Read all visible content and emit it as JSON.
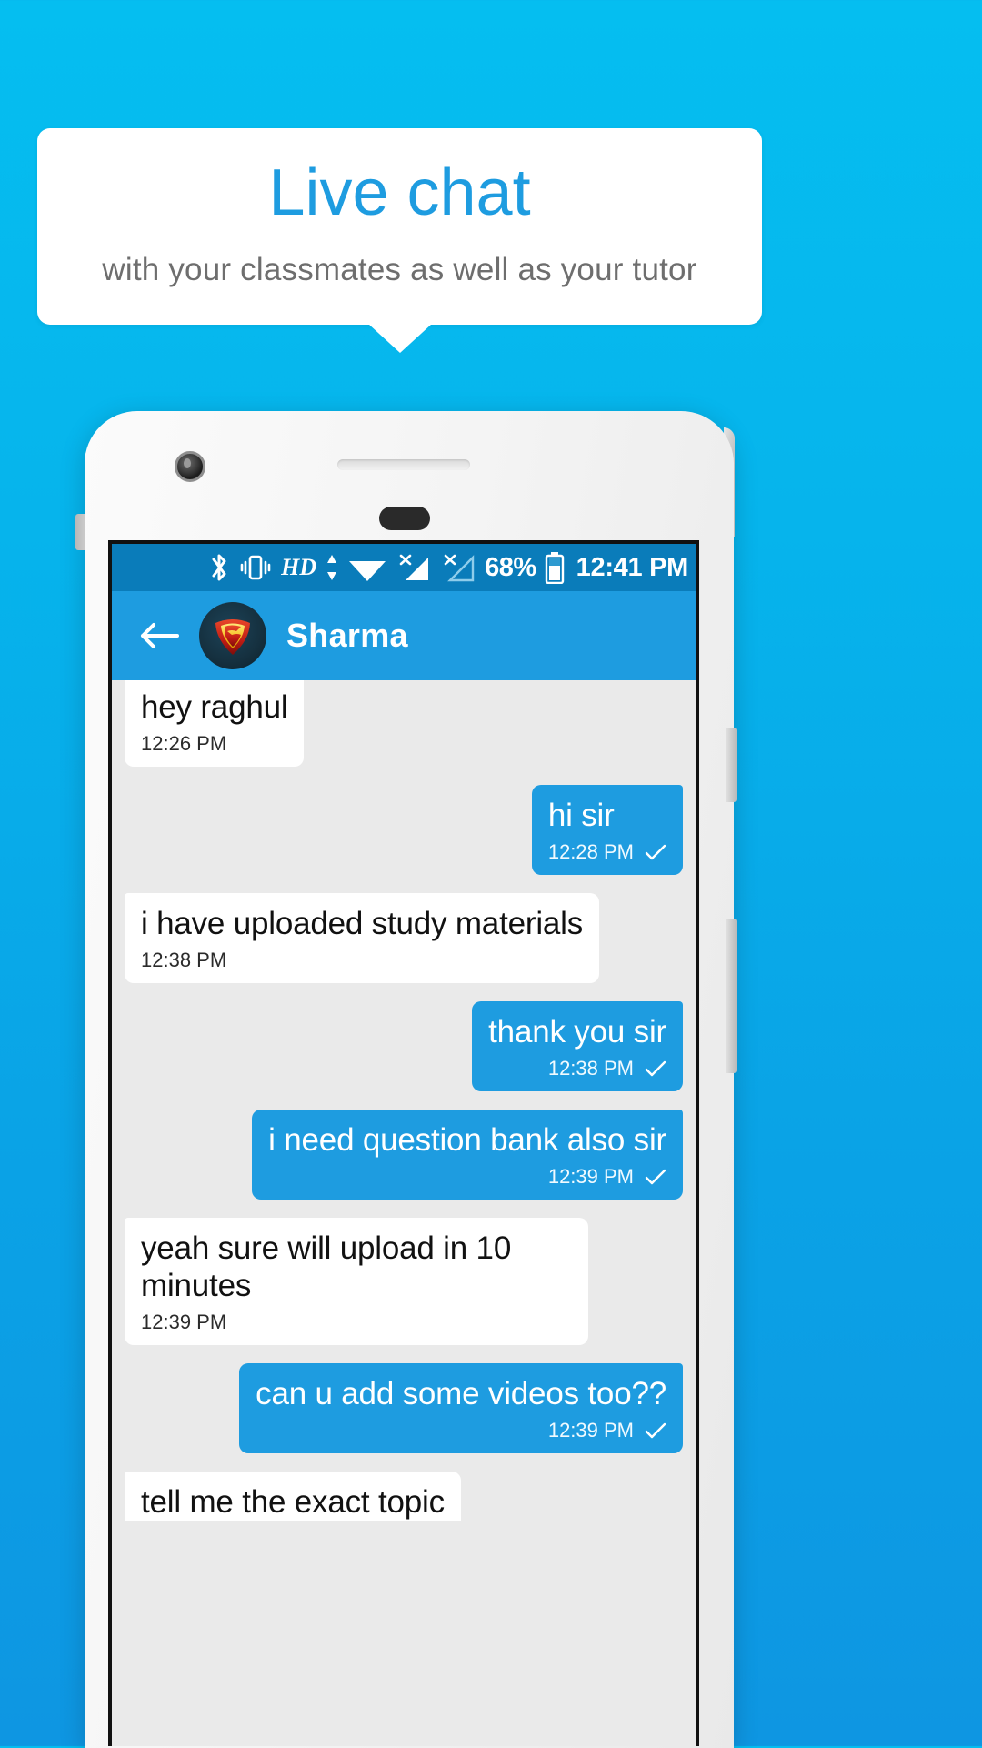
{
  "promo": {
    "title": "Live chat",
    "subtitle": "with your classmates as well as your tutor",
    "title_color": "#1E9CE0",
    "subtitle_color": "#6E6E6E",
    "background_color": "#FFFFFF"
  },
  "background": {
    "color_top": "#05BEF0",
    "color_bottom": "#0E96E2"
  },
  "phone": {
    "body_color": "#F4F4F4",
    "camera": "camera-icon",
    "speaker": "earpiece-speaker",
    "sensor": "proximity-sensor"
  },
  "status_bar": {
    "background_color": "#0A7CBA",
    "icons": [
      "bluetooth-icon",
      "vibrate-icon",
      "hd-voice-icon",
      "data-transfer-icon",
      "wifi-icon",
      "signal-sim1-no-service-icon",
      "signal-sim2-no-service-icon"
    ],
    "hd_label": "HD",
    "battery_percent": "68%",
    "battery_icon": "battery-icon",
    "time": "12:41 PM"
  },
  "toolbar": {
    "background_color": "#1E9CE0",
    "back_icon": "back-arrow-icon",
    "avatar_icon": "superman-avatar",
    "contact_name": "Sharma"
  },
  "chat": {
    "background_color": "#EAEAEA",
    "incoming_bubble_color": "#FFFFFF",
    "outgoing_bubble_color": "#1E9CE0",
    "messages": [
      {
        "text": "hey raghul",
        "time": "12:26 PM",
        "direction": "incoming",
        "clipped_top": true
      },
      {
        "text": "hi sir",
        "time": "12:28 PM",
        "direction": "outgoing",
        "status": "delivered"
      },
      {
        "text": "i have uploaded study materials",
        "time": "12:38 PM",
        "direction": "incoming"
      },
      {
        "text": "thank you sir",
        "time": "12:38 PM",
        "direction": "outgoing",
        "status": "delivered"
      },
      {
        "text": "i need question bank also sir",
        "time": "12:39 PM",
        "direction": "outgoing",
        "status": "delivered"
      },
      {
        "text": "yeah sure will upload in 10 minutes",
        "time": "12:39 PM",
        "direction": "incoming"
      },
      {
        "text": "can u add some videos too??",
        "time": "12:39 PM",
        "direction": "outgoing",
        "status": "delivered"
      },
      {
        "text": "tell me the exact topic",
        "time": "",
        "direction": "incoming",
        "clipped_bottom": true
      }
    ]
  }
}
